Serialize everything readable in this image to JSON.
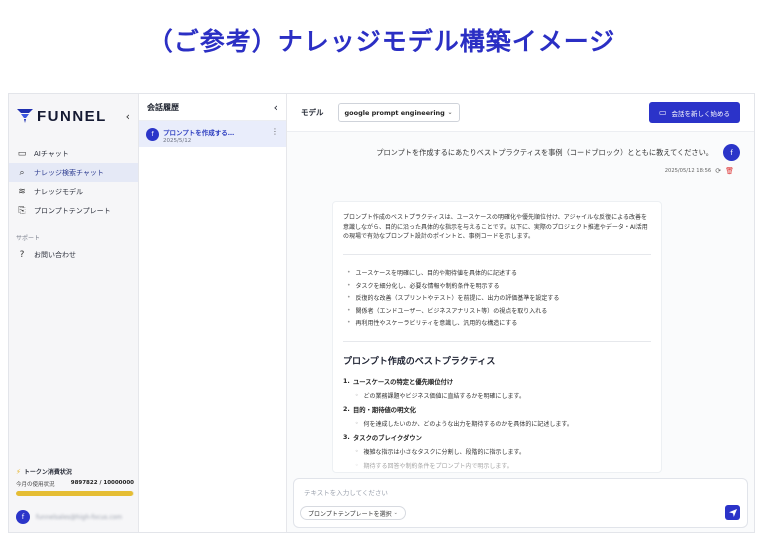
{
  "page_title": "（ご参考）ナレッジモデル構築イメージ",
  "brand": {
    "name": "FUNNEL",
    "accent": "#2b33c9"
  },
  "sidebar": {
    "collapse_icon": "‹",
    "items": [
      {
        "label": "AIチャット",
        "icon": "chat-bubble-icon",
        "glyph": "▭"
      },
      {
        "label": "ナレッジ検索チャット",
        "icon": "search-icon",
        "glyph": "⌕"
      },
      {
        "label": "ナレッジモデル",
        "icon": "database-icon",
        "glyph": "≋"
      },
      {
        "label": "プロンプトテンプレート",
        "icon": "document-icon",
        "glyph": "⎘"
      }
    ],
    "support_label": "サポート",
    "support_items": [
      {
        "label": "お問い合わせ",
        "icon": "help-circle-icon",
        "glyph": "?"
      }
    ],
    "token": {
      "title": "トークン消費状況",
      "usage_label": "今月の使用状況",
      "usage_value": "9897822 / 10000000",
      "used": 9897822,
      "limit": 10000000
    },
    "user": {
      "initial": "f",
      "email": "funnelsales@high-focus.com"
    }
  },
  "history": {
    "title": "会話履歴",
    "items": [
      {
        "title": "プロンプトを作成する…",
        "date": "2025/5/12",
        "initial": "f"
      }
    ]
  },
  "topbar": {
    "model_label": "モデル",
    "model_value": "google prompt engineering",
    "new_chat_label": "会話を新しく始める"
  },
  "chat": {
    "user_message": "プロンプトを作成するにあたりベストプラクティスを事例（コードブロック）とともに教えてください。",
    "user_initial": "f",
    "timestamp": "2025/05/12 18:56",
    "answer": {
      "intro": "プロンプト作成のベストプラクティスは、ユースケースの明確化や優先順位付け、アジャイルな反復による改善を意識しながら、目的に沿った具体的な指示を与えることです。以下に、実際のプロジェクト推進やデータ・AI活用の現場で有効なプロンプト設計のポイントと、事例コードを示します。",
      "bullets": [
        "ユースケースを明確にし、目的や期待値を具体的に記述する",
        "タスクを細分化し、必要な情報や制約条件を明示する",
        "反復的な改善（スプリントやテスト）を前提に、出力の評価基準を設定する",
        "関係者（エンドユーザー、ビジネスアナリスト等）の視点を取り入れる",
        "再利用性やスケーラビリティを意識し、汎用的な構造にする"
      ],
      "heading": "プロンプト作成のベストプラクティス",
      "steps": [
        {
          "num": "1.",
          "title": "ユースケースの特定と優先順位付け",
          "sub": "どの業務課題やビジネス価値に直結するかを明確にします。"
        },
        {
          "num": "2.",
          "title": "目的・期待値の明文化",
          "sub": "何を達成したいのか、どのような出力を期待するのかを具体的に記述します。"
        },
        {
          "num": "3.",
          "title": "タスクのブレイクダウン",
          "sub": "複雑な指示は小さなタスクに分割し、段階的に指示します。"
        }
      ],
      "trailing": "期待する回答や制約条件をプロンプト内で明示します。"
    }
  },
  "composer": {
    "placeholder": "テキストを入力してください",
    "template_label": "プロンプトテンプレートを選択"
  }
}
